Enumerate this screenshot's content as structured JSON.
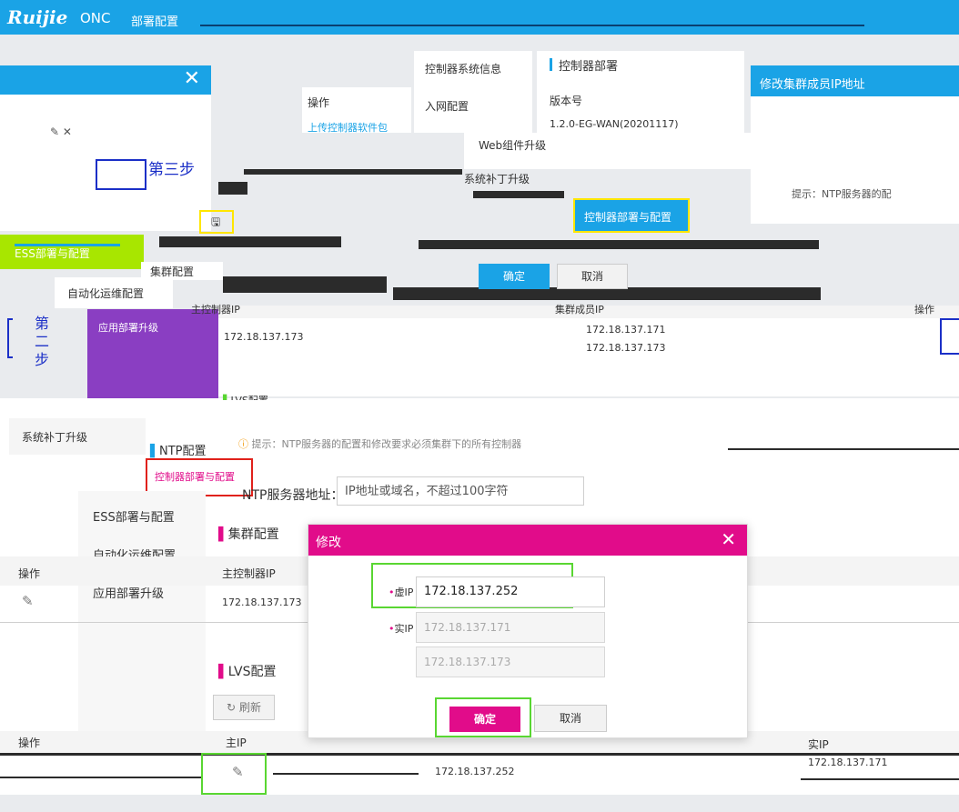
{
  "header": {
    "logo": "Ruijie",
    "app": "ONC",
    "page": "部署配置"
  },
  "top_panel": {
    "menu": {
      "sys_info": "控制器系统信息",
      "network": "入网配置",
      "web_upgrade": "Web组件升级",
      "patch": "系统补丁升级",
      "deploy_config": "控制器部署与配置",
      "ess": "ESS部署与配置",
      "auto_ops": "自动化运维配置",
      "app_upgrade": "应用部署升级",
      "ess_green": "ESS部署与配置"
    },
    "section_title": "控制器部署",
    "version_label": "版本号",
    "version_value": "1.2.0-EG-WAN(20201117)",
    "op_label": "操作",
    "upload_link": "上传控制器软件包",
    "edit_dialog_title": "修改集群成员IP地址",
    "cluster_title": "集群配置",
    "ntp_tip": "提示：NTP服务器的配",
    "btn_ok": "确定",
    "btn_cancel": "取消",
    "step2": "第二步",
    "step3": "第三步",
    "col_master": "主控制器IP",
    "col_member": "集群成员IP",
    "col_op": "操作",
    "master_ip": "172.18.137.173",
    "member_ip1": "172.18.137.171",
    "member_ip2": "172.18.137.173",
    "lvs_title": "LVS配置"
  },
  "bottom_panel": {
    "patch": "系统补丁升级",
    "ntp_title": "NTP配置",
    "ntp_tip": "提示：NTP服务器的配置和修改要求必须集群下的所有控制器",
    "deploy_config": "控制器部署与配置",
    "ntp_label": "NTP服务器地址：",
    "ntp_placeholder": "IP地址或域名，不超过100字符",
    "ess": "ESS部署与配置",
    "auto_ops": "自动化运维配置",
    "app_upgrade": "应用部署升级",
    "cluster_title": "集群配置",
    "op_label": "操作",
    "col_master": "主控制器IP",
    "master_ip": "172.18.137.173",
    "lvs_title": "LVS配置",
    "refresh": "刷新",
    "op_label2": "操作",
    "col_vip": "主IP",
    "col_realip": "实IP",
    "vip_row": "172.18.137.252",
    "realip_row": "172.18.137.171"
  },
  "modal": {
    "title": "修改",
    "vip_label": "虚IP",
    "vip_value": "172.18.137.252",
    "realip_label": "实IP",
    "realip1": "172.18.137.171",
    "realip2": "172.18.137.173",
    "ok": "确定",
    "cancel": "取消"
  },
  "colors": {
    "blue": "#1aa3e6",
    "pink": "#e10c8a",
    "green": "#59d632",
    "purple": "#8a3ec2",
    "lime": "#a8e600"
  }
}
